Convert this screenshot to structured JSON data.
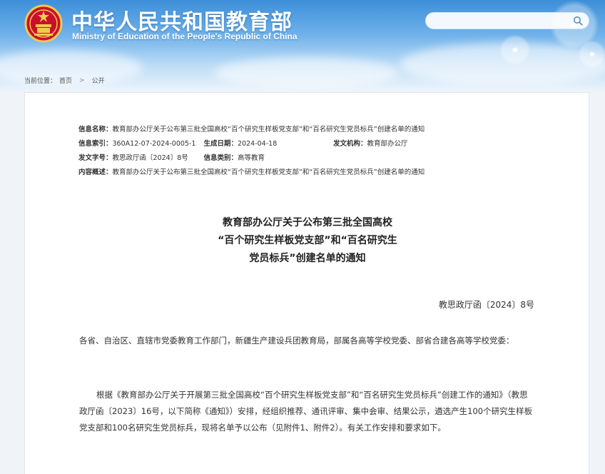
{
  "header": {
    "site_title": "中华人民共和国教育部",
    "site_subtitle": "Ministry of Education of the People's Republic of China",
    "emblem_icon": "national-emblem-icon",
    "search": {
      "placeholder": "",
      "icon": "search-icon"
    },
    "colors": {
      "sky_top": "#3d8fd9",
      "sky_bottom": "#edf4fb"
    }
  },
  "breadcrumb": {
    "label": "当前位置：",
    "items": [
      "首页",
      "公开"
    ]
  },
  "meta": {
    "name_label": "信息名称：",
    "name_value": "教育部办公厅关于公布第三批全国高校“百个研究生样板党支部”和“百名研究生党员标兵”创建名单的通知",
    "index_label": "信息索引：",
    "index_value": "360A12-07-2024-0005-1",
    "date_label": "生成日期：",
    "date_value": "2024-04-18",
    "org_label": "发文机构：",
    "org_value": "教育部办公厅",
    "docno_label": "发文字号：",
    "docno_value": "教思政厅函〔2024〕8号",
    "category_label": "信息类别：",
    "category_value": "高等教育",
    "summary_label": "内容概述：",
    "summary_value": "教育部办公厅关于公布第三批全国高校“百个研究生样板党支部”和“百名研究生党员标兵”创建名单的通知"
  },
  "document": {
    "title_lines": [
      "教育部办公厅关于公布第三批全国高校",
      "“百个研究生样板党支部”和“百名研究生",
      "党员标兵”创建名单的通知"
    ],
    "number": "教思政厅函〔2024〕8号",
    "paragraph_1": "各省、自治区、直辖市党委教育工作部门，新疆生产建设兵团教育局，部属各高等学校党委、部省合建各高等学校党委：",
    "paragraph_2": "根据《教育部办公厅关于开展第三批全国高校“百个研究生样板党支部”和“百名研究生党员标兵”创建工作的通知》（教思政厅函〔2023〕16号，以下简称《通知》）安排，经组织推荐、通讯评审、集中会审、结果公示，遴选产生100个研究生样板党支部和100名研究生党员标兵，现将名单予以公布（见附件1、附件2）。有关工作安排和要求如下。"
  }
}
